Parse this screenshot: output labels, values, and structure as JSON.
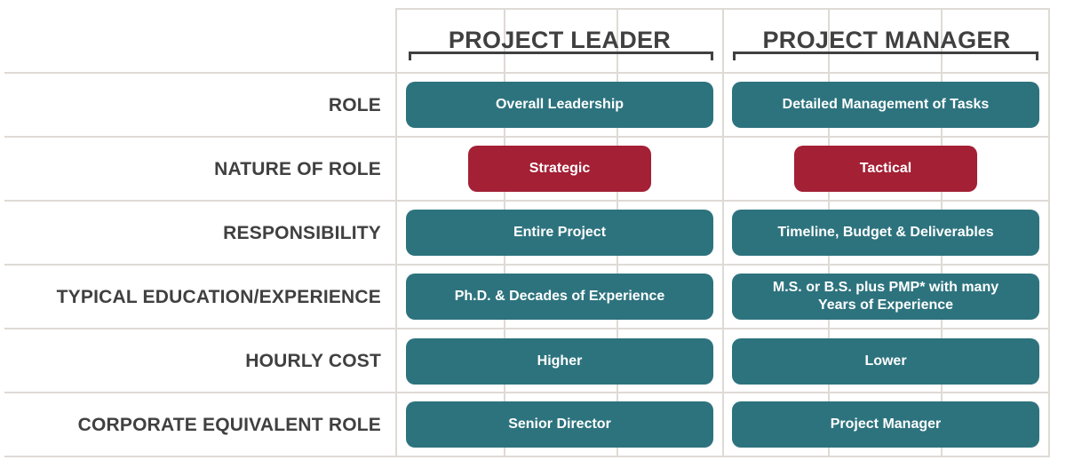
{
  "colors": {
    "teal": "#2d737e",
    "red": "#a32035",
    "text": "#404040",
    "grid": "#dedad5"
  },
  "columns": [
    {
      "title": "PROJECT LEADER"
    },
    {
      "title": "PROJECT MANAGER"
    }
  ],
  "rows": [
    {
      "label": "ROLE",
      "style": "teal",
      "leader": "Overall Leadership",
      "manager": "Detailed Management of Tasks"
    },
    {
      "label": "NATURE OF ROLE",
      "style": "red",
      "leader": "Strategic",
      "manager": "Tactical"
    },
    {
      "label": "RESPONSIBILITY",
      "style": "teal",
      "leader": "Entire Project",
      "manager": "Timeline, Budget & Deliverables"
    },
    {
      "label": "TYPICAL EDUCATION/EXPERIENCE",
      "style": "teal",
      "leader": "Ph.D. & Decades of Experience",
      "manager": "M.S. or B.S. plus PMP* with many Years of Experience"
    },
    {
      "label": "HOURLY COST",
      "style": "teal",
      "leader": "Higher",
      "manager": "Lower"
    },
    {
      "label": "CORPORATE EQUIVALENT ROLE",
      "style": "teal",
      "leader": "Senior Director",
      "manager": "Project Manager"
    }
  ]
}
